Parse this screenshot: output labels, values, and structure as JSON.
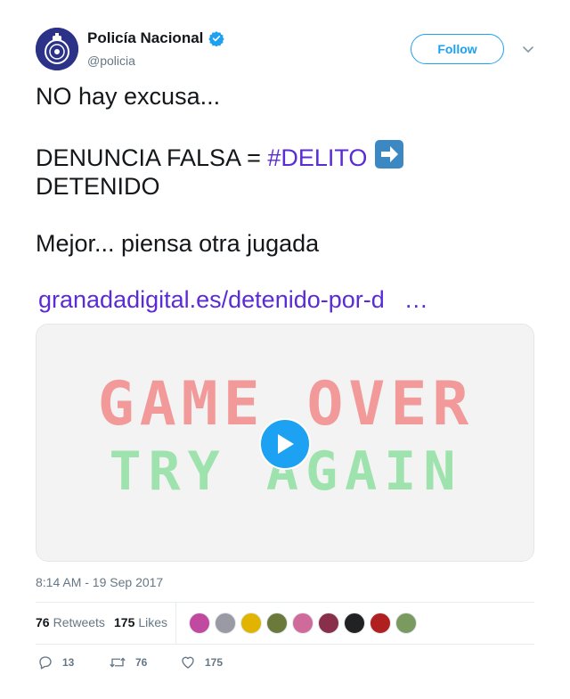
{
  "author": {
    "name": "Policía Nacional",
    "handle": "@policia",
    "verified_color": "#1da1f2"
  },
  "follow_label": "Follow",
  "tweet": {
    "line1": "NO hay excusa...",
    "line2_text": "DENUNCIA FALSA = ",
    "line2_hashtag": "#DELITO",
    "arrow_icon": "right-arrow-emoji",
    "line3": "DETENIDO",
    "line4": "Mejor... piensa otra jugada",
    "link": "granadadigital.es/detenido-por-d",
    "link_ellipsis": "…"
  },
  "media": {
    "text_top": "GAME OVER",
    "text_bottom": "TRY AGAIN",
    "top_color": "#f29a9a",
    "bottom_color": "#9ee3ad",
    "play_icon": "play-icon"
  },
  "timestamp": "8:14 AM - 19 Sep 2017",
  "stats": {
    "retweets_count": "76",
    "retweets_label": "Retweets",
    "likes_count": "175",
    "likes_label": "Likes",
    "liker_colors": [
      "#c04aa0",
      "#9a9aa5",
      "#e0b400",
      "#6b7a3a",
      "#d06a9a",
      "#8a2f4a",
      "#222222",
      "#b02020",
      "#7a9a60"
    ]
  },
  "actions": {
    "replies": "13",
    "retweets": "76",
    "likes": "175"
  },
  "colors": {
    "link": "#5b2bd6",
    "accent": "#1da1f2",
    "muted": "#657786"
  }
}
